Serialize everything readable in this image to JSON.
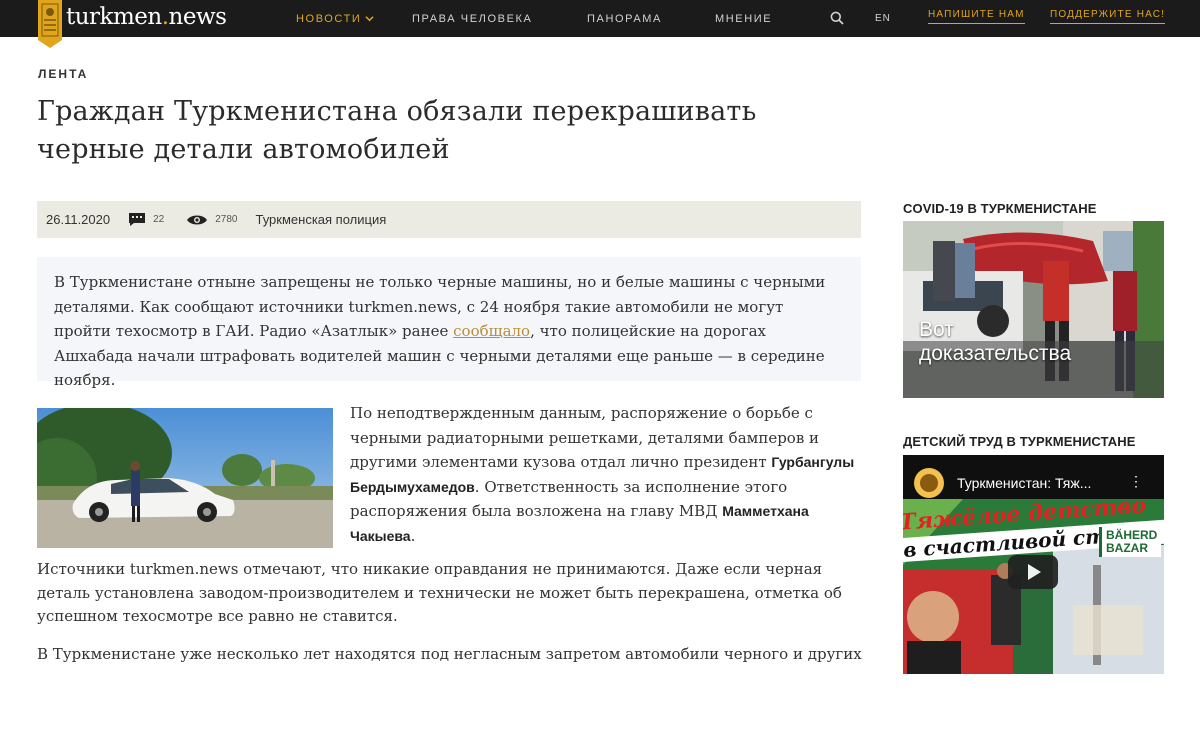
{
  "header": {
    "logo": {
      "text_before": "turkmen",
      "text_dot": ".",
      "text_after": "news"
    },
    "nav": [
      {
        "label": "НОВОСТИ",
        "active": true,
        "has_dropdown": true
      },
      {
        "label": "ПРАВА ЧЕЛОВЕКА",
        "active": false
      },
      {
        "label": "ПАНОРАМА",
        "active": false
      },
      {
        "label": "МНЕНИЕ",
        "active": false
      }
    ],
    "language": "EN",
    "write_us": "НАПИШИТЕ НАМ",
    "support": "ПОДДЕРЖИТЕ НАС!",
    "icons": {
      "search": "search-icon",
      "dropdown": "chevron-down-icon"
    }
  },
  "article": {
    "rubric": "ЛЕНТА",
    "title": "Граждан Туркменистана обязали перекрашивать черные детали автомобилей",
    "meta": {
      "date": "26.11.2020",
      "comments": "22",
      "views": "2780",
      "tag": "Туркменская полиция"
    },
    "lead": {
      "before_link": "В Туркменистане отныне запрещены не только черные машины, но и белые машины с черными деталями. Как сообщают источники turkmen.news, с 24 ноября такие автомобили не могут пройти техосмотр в ГАИ. Радио «Азатлык» ранее ",
      "link": "сообщало",
      "after_link": ", что полицейские на дорогах Ашхабада начали штрафовать водителей машин с черными деталями еще раньше — в середине ноября."
    },
    "paragraph_side": {
      "part1": "По неподтвержденным данным, распоряжение о борьбе с черными радиаторными решетками, деталями бамперов и другими элементами кузова отдал лично президент ",
      "bold1": "Гурбангулы Бердымухамедов",
      "part2": ". Ответственность за исполнение этого распоряжения была возложена на главу МВД ",
      "bold2": "Мамметхана Чакыева",
      "part3": "."
    },
    "paragraph_1": "Источники turkmen.news отмечают, что никакие оправдания не принимаются. Даже если черная деталь установлена заводом-производителем и технически не может быть перекрашена, отметка об успешном техосмотре все равно не ставится.",
    "paragraph_2": "В Туркменистане уже несколько лет находятся под негласным запретом автомобили черного и других"
  },
  "sidebar": {
    "covid": {
      "heading": "COVID-19 В ТУРКМЕНИСТАНЕ",
      "caption_line1": "Вот",
      "caption_line2": "доказательства"
    },
    "child_labor": {
      "heading": "ДЕТСКИЙ ТРУД В ТУРКМЕНИСТАНЕ",
      "video_title": "Туркменистан: Тяж...",
      "banner_line1": "Тяжёлое детство",
      "banner_line2": "в счастливой стране",
      "sign_line1": "BÄHERD",
      "sign_line2": "BAZAR"
    }
  },
  "colors": {
    "topbar": "#1b1b1b",
    "accent": "#e0a51c",
    "meta_bg": "#ecebe3",
    "lead_bg": "#f4f6f9",
    "link": "#b98f3e"
  }
}
